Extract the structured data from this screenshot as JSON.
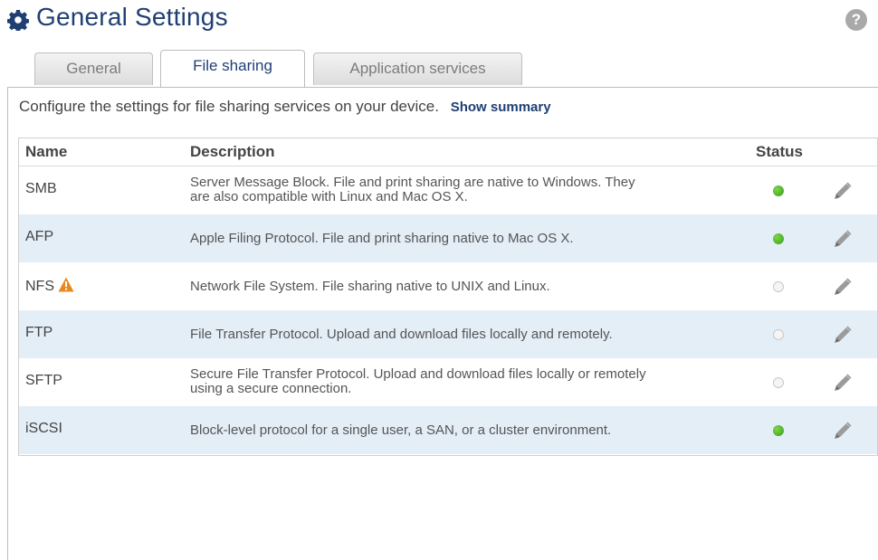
{
  "header": {
    "title": "General Settings",
    "icon": "gear-icon",
    "help_label": "?"
  },
  "tabs": [
    {
      "label": "General",
      "active": false
    },
    {
      "label": "File sharing",
      "active": true
    },
    {
      "label": "Application services",
      "active": false
    }
  ],
  "intro": {
    "text": "Configure the settings for file sharing services on your device.",
    "link": "Show summary"
  },
  "table": {
    "columns": [
      "Name",
      "Description",
      "Status"
    ],
    "rows": [
      {
        "name": "SMB",
        "desc": [
          "Server Message Block. File and print sharing are native to Windows. They",
          "are also compatible with Linux and Mac OS X."
        ],
        "status": "on",
        "warning": false
      },
      {
        "name": "AFP",
        "desc": [
          "Apple Filing Protocol. File and print sharing native to Mac OS X."
        ],
        "status": "on",
        "warning": false
      },
      {
        "name": "NFS",
        "desc": [
          "Network File System. File sharing native to UNIX and Linux."
        ],
        "status": "off",
        "warning": true
      },
      {
        "name": "FTP",
        "desc": [
          "File Transfer Protocol. Upload and download files locally and remotely."
        ],
        "status": "off",
        "warning": false
      },
      {
        "name": "SFTP",
        "desc": [
          "Secure File Transfer Protocol. Upload and download files locally or remotely",
          "using a secure connection."
        ],
        "status": "off",
        "warning": false
      },
      {
        "name": "iSCSI",
        "desc": [
          "Block-level protocol for a single user, a SAN, or a cluster environment."
        ],
        "status": "on",
        "warning": false
      }
    ]
  },
  "colors": {
    "title": "#1f3f73",
    "row_alt": "#e4eef7",
    "status_on": "#4caf28",
    "warning": "#e8891e"
  }
}
